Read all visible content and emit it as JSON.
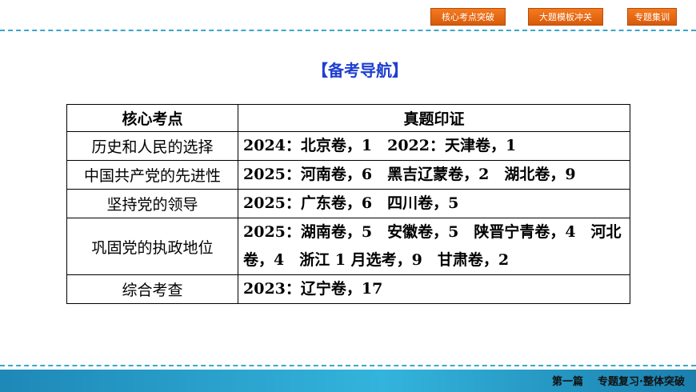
{
  "nav": {
    "btn1": "核心考点突破",
    "btn2": "大题模板冲关",
    "btn3": "专题集训"
  },
  "title": "【备考导航】",
  "table": {
    "headers": [
      "核心考点",
      "真题印证"
    ],
    "rows": [
      {
        "topic": "历史和人民的选择",
        "evidence": "2024：北京卷，1　2022：天津卷，1"
      },
      {
        "topic": "中国共产党的先进性",
        "evidence": "2025：河南卷，6　黑吉辽蒙卷，2　湖北卷，9"
      },
      {
        "topic": "坚持党的领导",
        "evidence": "2025：广东卷，6　四川卷，5"
      },
      {
        "topic": "巩固党的执政地位",
        "evidence": "2025：湖南卷，5　安徽卷，5　陕晋宁青卷，4　河北卷，4　浙江 1 月选考，9　甘肃卷，2"
      },
      {
        "topic": "综合考查",
        "evidence": "2023：辽宁卷，17"
      }
    ]
  },
  "footer": {
    "part": "第一篇",
    "section": "专题复习·整体突破"
  }
}
